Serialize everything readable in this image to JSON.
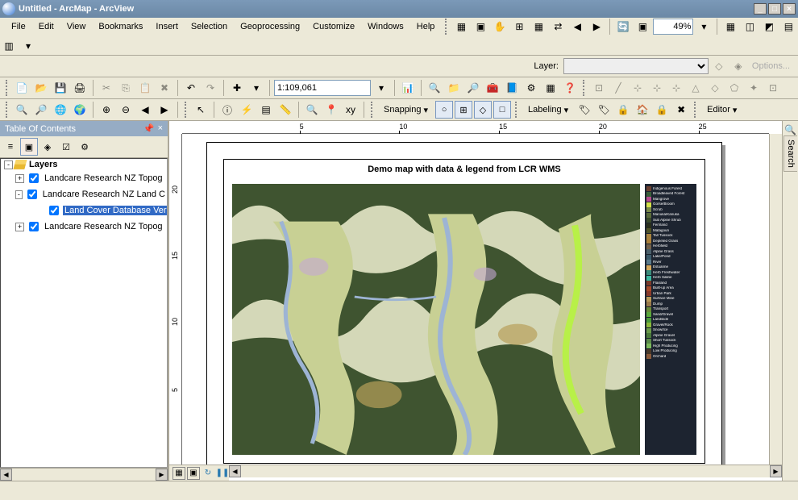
{
  "window": {
    "title": "Untitled - ArcMap - ArcView"
  },
  "menu": {
    "items": [
      "File",
      "Edit",
      "View",
      "Bookmarks",
      "Insert",
      "Selection",
      "Geoprocessing",
      "Customize",
      "Windows",
      "Help"
    ]
  },
  "toolbar": {
    "zoom_percent": "49%",
    "layer_label": "Layer:",
    "options_label": "Options...",
    "scale": "1:109,061",
    "snapping_label": "Snapping",
    "labeling_label": "Labeling",
    "editor_label": "Editor"
  },
  "toc": {
    "title": "Table Of Contents",
    "root": "Layers",
    "items": [
      {
        "label": "Landcare Research NZ Topog",
        "checked": true,
        "exp": "+",
        "indent": 2
      },
      {
        "label": "Landcare Research NZ Land C",
        "checked": true,
        "exp": "-",
        "indent": 2
      },
      {
        "label": "Land Cover Database Ver",
        "checked": true,
        "exp": "",
        "indent": 4,
        "selected": true
      },
      {
        "label": "Landcare Research NZ Topog",
        "checked": true,
        "exp": "+",
        "indent": 2
      }
    ]
  },
  "map": {
    "title": "Demo map with data & legend from LCR WMS",
    "ruler_h": [
      "5",
      "10",
      "15",
      "20",
      "25"
    ],
    "ruler_v": [
      "5",
      "10",
      "15",
      "20"
    ]
  },
  "legend": {
    "items": [
      {
        "c": "#6b3f2f",
        "t": "Indigenous Forest"
      },
      {
        "c": "#3a5f3a",
        "t": "Broadleaved Forest"
      },
      {
        "c": "#b84a8f",
        "t": "Mangrove"
      },
      {
        "c": "#d4e04a",
        "t": "Gorse/Broom"
      },
      {
        "c": "#7a8a4a",
        "t": "Scrub"
      },
      {
        "c": "#5a6a3a",
        "t": "Manuka/Kanuka"
      },
      {
        "c": "#3a4a2a",
        "t": "Sub Alpine Shrub"
      },
      {
        "c": "#2a2f1a",
        "t": "Fernland"
      },
      {
        "c": "#4f5228",
        "t": "Matagouri"
      },
      {
        "c": "#a8833f",
        "t": "Tall Tussock"
      },
      {
        "c": "#aa7f3a",
        "t": "Depleted Grass"
      },
      {
        "c": "#72604a",
        "t": "Herbfield"
      },
      {
        "c": "#4a5f6a",
        "t": "Alpine Grass"
      },
      {
        "c": "#3a5a6a",
        "t": "Lake/Pond"
      },
      {
        "c": "#5a7a8a",
        "t": "River"
      },
      {
        "c": "#d4a85a",
        "t": "Estuarine"
      },
      {
        "c": "#3a8a7a",
        "t": "Herb Freshwater"
      },
      {
        "c": "#3ab8a0",
        "t": "Herb Saline"
      },
      {
        "c": "#7a3a2a",
        "t": "Flaxland"
      },
      {
        "c": "#a84a2a",
        "t": "Built-up Area"
      },
      {
        "c": "#8a3a2a",
        "t": "Urban Park"
      },
      {
        "c": "#b89a5a",
        "t": "Surface Mine"
      },
      {
        "c": "#9a7a4a",
        "t": "Dump"
      },
      {
        "c": "#6a8a3a",
        "t": "Transport"
      },
      {
        "c": "#5aa83a",
        "t": "Sand/Gravel"
      },
      {
        "c": "#4a9a3a",
        "t": "Landslide"
      },
      {
        "c": "#8ab83a",
        "t": "Gravel/Rock"
      },
      {
        "c": "#6a9a4a",
        "t": "Snow/Ice"
      },
      {
        "c": "#4a7a3a",
        "t": "Alpine Gravel"
      },
      {
        "c": "#5a8a4a",
        "t": "Short Tussock"
      },
      {
        "c": "#7ab85a",
        "t": "High Producing"
      },
      {
        "c": "#4a3a2a",
        "t": "Low Producing"
      },
      {
        "c": "#8a5a3a",
        "t": "Orchard"
      }
    ]
  },
  "sidebar": {
    "search": "Search"
  }
}
